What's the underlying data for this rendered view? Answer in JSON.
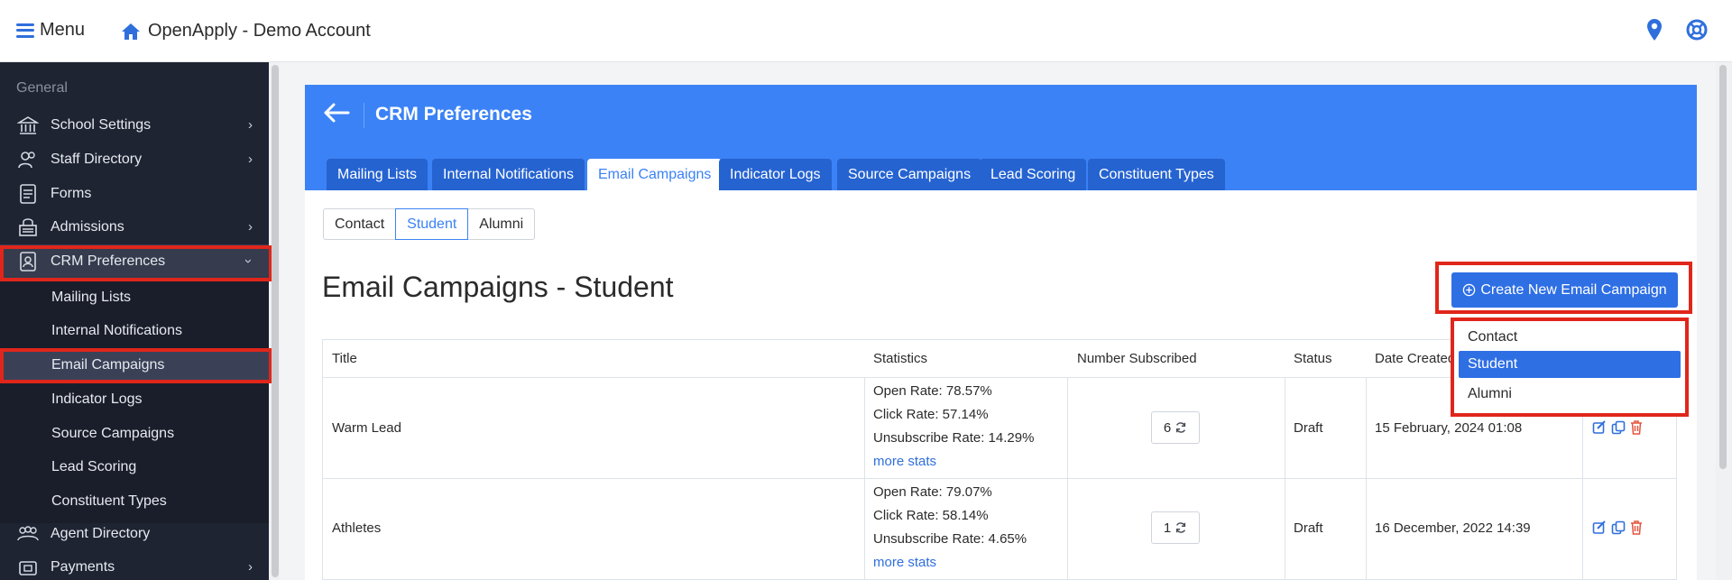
{
  "topbar": {
    "menu_label": "Menu",
    "brand": "OpenApply - Demo Account"
  },
  "sidebar": {
    "group_label": "General",
    "items": [
      {
        "label": "School Settings",
        "icon": "bank-icon"
      },
      {
        "label": "Staff Directory",
        "icon": "staff-icon"
      },
      {
        "label": "Forms",
        "icon": "forms-icon"
      },
      {
        "label": "Admissions",
        "icon": "admissions-icon"
      },
      {
        "label": "CRM Preferences",
        "icon": "crm-icon"
      }
    ],
    "subitems": [
      {
        "label": "Mailing Lists"
      },
      {
        "label": "Internal Notifications"
      },
      {
        "label": "Email Campaigns"
      },
      {
        "label": "Indicator Logs"
      },
      {
        "label": "Source Campaigns"
      },
      {
        "label": "Lead Scoring"
      },
      {
        "label": "Constituent Types"
      }
    ],
    "bottom_items": [
      {
        "label": "Agent Directory",
        "icon": "agents-icon"
      },
      {
        "label": "Payments",
        "icon": "payments-icon"
      }
    ]
  },
  "page": {
    "title": "CRM Preferences",
    "tabs": [
      "Mailing Lists",
      "Internal Notifications",
      "Email Campaigns",
      "Indicator Logs",
      "Source Campaigns",
      "Lead Scoring",
      "Constituent Types"
    ],
    "segments": [
      "Contact",
      "Student",
      "Alumni"
    ],
    "section_title": "Email Campaigns - Student",
    "create_button": "Create New Email Campaign",
    "dropdown": [
      "Contact",
      "Student",
      "Alumni"
    ]
  },
  "table": {
    "headers": [
      "Title",
      "Statistics",
      "Number Subscribed",
      "Status",
      "Date Created"
    ],
    "rows": [
      {
        "title": "Warm Lead",
        "open_rate": "Open Rate: 78.57%",
        "click_rate": "Click Rate: 57.14%",
        "unsub_rate": "Unsubscribe Rate: 14.29%",
        "more": "more stats",
        "subscribed": "6",
        "status": "Draft",
        "date": "15 February, 2024 01:08"
      },
      {
        "title": "Athletes",
        "open_rate": "Open Rate: 79.07%",
        "click_rate": "Click Rate: 58.14%",
        "unsub_rate": "Unsubscribe Rate: 4.65%",
        "more": "more stats",
        "subscribed": "1",
        "status": "Draft",
        "date": "16 December, 2022 14:39"
      }
    ]
  },
  "colors": {
    "brand_blue": "#3b82f6",
    "highlight_red": "#e0261b",
    "sidebar_bg": "#1f2433"
  }
}
